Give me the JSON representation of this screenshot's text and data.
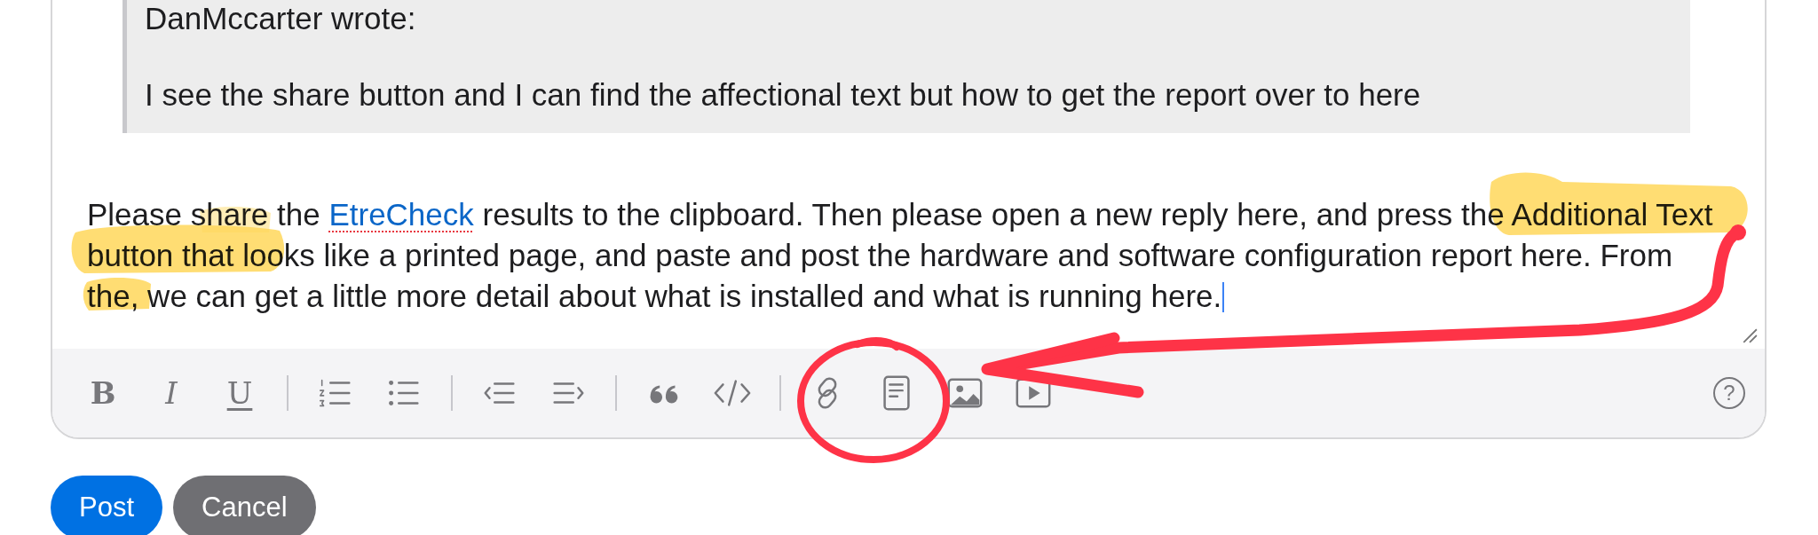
{
  "quote": {
    "author_line": "DanMccarter wrote:",
    "text": "I see the share button and I can find the affectional text but how to get the report over to here"
  },
  "reply": {
    "before": "Please share the ",
    "link": {
      "text": "EtreCheck",
      "misspelled": true
    },
    "after": " results to the clipboard. Then please open a new reply here, and press the Additional Text button that looks like a printed page, and paste and post the hardware and software configuration report here. From the, we can get a little more detail about what is installed and what is running here.",
    "caret": true
  },
  "toolbar": {
    "groups": [
      [
        {
          "kind": "bold",
          "label": "B"
        },
        {
          "kind": "italic",
          "label": "I"
        },
        {
          "kind": "underline",
          "label": "U"
        }
      ],
      [
        {
          "kind": "ordered-list"
        },
        {
          "kind": "bullet-list"
        }
      ],
      [
        {
          "kind": "outdent"
        },
        {
          "kind": "indent"
        }
      ],
      [
        {
          "kind": "quote"
        },
        {
          "kind": "code"
        }
      ],
      [
        {
          "kind": "link"
        },
        {
          "kind": "document"
        },
        {
          "kind": "image"
        },
        {
          "kind": "video"
        }
      ]
    ],
    "help": {
      "label": "?"
    }
  },
  "buttons": [
    {
      "label": "Post",
      "kind": "primary"
    },
    {
      "label": "Cancel",
      "kind": "secondary"
    }
  ]
}
